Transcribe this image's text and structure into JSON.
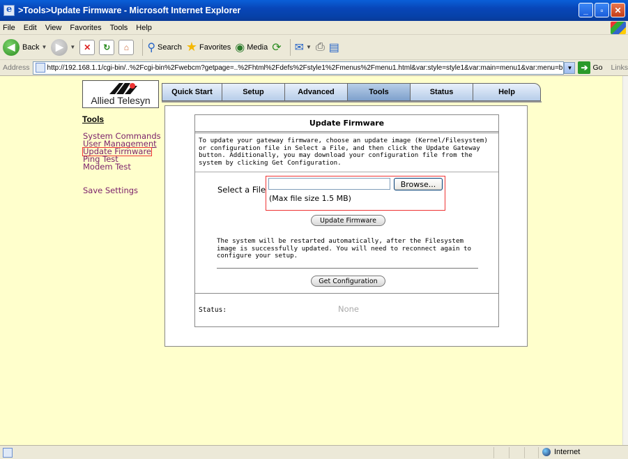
{
  "window": {
    "title": ">Tools>Update Firmware - Microsoft Internet Explorer",
    "buttons": [
      "_",
      "▫",
      "✕"
    ]
  },
  "menubar": [
    "File",
    "Edit",
    "View",
    "Favorites",
    "Tools",
    "Help"
  ],
  "toolbar": {
    "back_label": "Back",
    "search_label": "Search",
    "favorites_label": "Favorites",
    "media_label": "Media"
  },
  "address": {
    "label": "Address",
    "url": "http://192.168.1.1/cgi-bin/..%2Fcgi-bin%2Fwebcm?getpage=..%2Fhtml%2Fdefs%2Fstyle1%2Fmenus%2Fmenu1.html&var:style=style1&var:main=menu1&var:menu=b",
    "go_label": "Go",
    "links_label": "Links"
  },
  "logo": {
    "text": "Allied Telesyn"
  },
  "nav": {
    "tabs": [
      {
        "label": "Quick Start",
        "active": false
      },
      {
        "label": "Setup",
        "active": false
      },
      {
        "label": "Advanced",
        "active": false
      },
      {
        "label": "Tools",
        "active": true
      },
      {
        "label": "Status",
        "active": false
      },
      {
        "label": "Help",
        "active": false
      }
    ]
  },
  "sidebar": {
    "title": "Tools",
    "items": [
      "System Commands",
      "User Management",
      "Update Firmware",
      "Ping Test",
      "Modem Test"
    ],
    "save": "Save Settings"
  },
  "panel": {
    "title": "Update Firmware",
    "description": "To update your gateway firmware, choose an update image (Kernel/Filesystem) or configuration file in Select a File, and then click the Update Gateway button. Additionally, you may download your configuration file from the system by clicking Get Configuration.",
    "select_label": "Select a File",
    "file_value": "",
    "browse_label": "Browse...",
    "max_size": "(Max file size 1.5 MB)",
    "update_button": "Update Firmware",
    "note": "The system will be restarted automatically, after the Filesystem image is successfully updated. You will need to reconnect again to configure your setup.",
    "get_config_button": "Get Configuration",
    "status_label": "Status:",
    "status_value": "None"
  },
  "statusbar": {
    "zone": "Internet"
  }
}
